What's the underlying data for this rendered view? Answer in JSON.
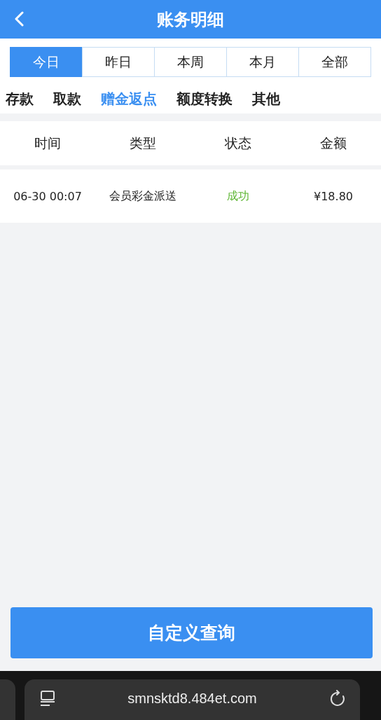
{
  "header": {
    "title": "账务明细"
  },
  "periods": [
    {
      "label": "今日",
      "selected": true
    },
    {
      "label": "昨日",
      "selected": false
    },
    {
      "label": "本周",
      "selected": false
    },
    {
      "label": "本月",
      "selected": false
    },
    {
      "label": "全部",
      "selected": false
    }
  ],
  "categories": [
    {
      "label": "存款",
      "selected": false
    },
    {
      "label": "取款",
      "selected": false
    },
    {
      "label": "赠金返点",
      "selected": true
    },
    {
      "label": "额度转换",
      "selected": false
    },
    {
      "label": "其他",
      "selected": false
    }
  ],
  "table": {
    "columns": [
      "时间",
      "类型",
      "状态",
      "金额"
    ],
    "rows": [
      {
        "time": "06-30 00:07",
        "type": "会员彩金派送",
        "status": "成功",
        "color": "#5cb531",
        "amount": "¥18.80"
      }
    ]
  },
  "query_button": "自定义查询",
  "browser_bar": {
    "url": "smnsktd8.484et.com"
  }
}
